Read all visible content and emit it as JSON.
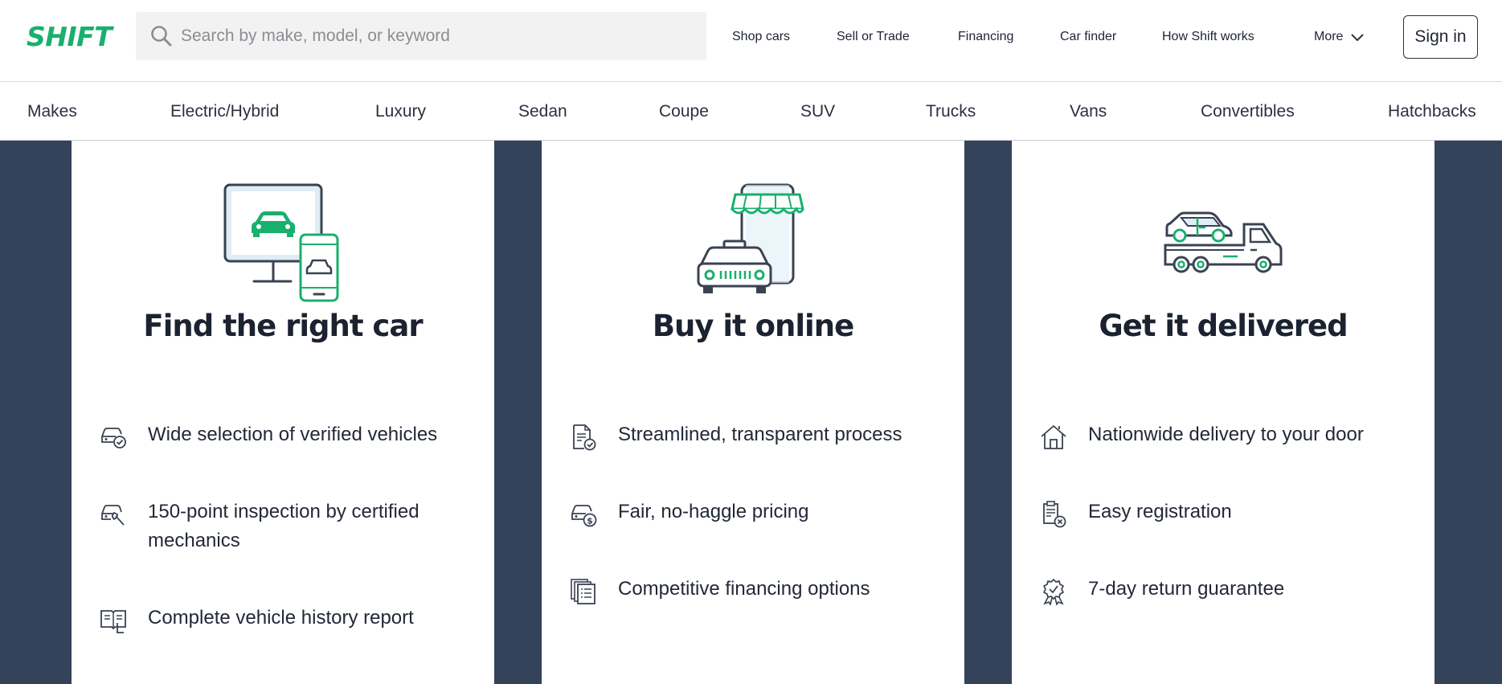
{
  "header": {
    "logo": "SHIFT",
    "search": {
      "placeholder": "Search by make, model, or keyword",
      "icon": "search-icon"
    },
    "nav": [
      {
        "label": "Shop cars"
      },
      {
        "label": "Sell or Trade"
      },
      {
        "label": "Financing"
      },
      {
        "label": "Car finder"
      },
      {
        "label": "How Shift works"
      },
      {
        "label": "More",
        "icon": "chevron-down-icon"
      }
    ],
    "sign_in": "Sign in"
  },
  "categories": [
    "Makes",
    "Electric/Hybrid",
    "Luxury",
    "Sedan",
    "Coupe",
    "SUV",
    "Trucks",
    "Vans",
    "Convertibles",
    "Hatchbacks"
  ],
  "cards": [
    {
      "title": "Find the right car",
      "illustration": "monitor-phone-car-icon",
      "features": [
        {
          "icon": "car-check-icon",
          "text": "Wide selection of verified vehicles"
        },
        {
          "icon": "car-wrench-icon",
          "text": "150-point inspection by certified mechanics"
        },
        {
          "icon": "report-book-icon",
          "text": "Complete vehicle history report"
        }
      ]
    },
    {
      "title": "Buy it online",
      "illustration": "phone-shop-car-icon",
      "features": [
        {
          "icon": "document-check-icon",
          "text": "Streamlined, transparent process"
        },
        {
          "icon": "car-dollar-icon",
          "text": "Fair, no-haggle pricing"
        },
        {
          "icon": "stacked-documents-icon",
          "text": "Competitive financing options"
        }
      ]
    },
    {
      "title": "Get it delivered",
      "illustration": "tow-truck-car-icon",
      "features": [
        {
          "icon": "house-icon",
          "text": "Nationwide delivery to your door"
        },
        {
          "icon": "registration-icon",
          "text": "Easy registration"
        },
        {
          "icon": "award-badge-icon",
          "text": "7-day return guarantee"
        }
      ]
    }
  ],
  "colors": {
    "brand_green": "#19b06d",
    "dark_navy": "#34435a",
    "icon_stroke": "#3a4252"
  }
}
